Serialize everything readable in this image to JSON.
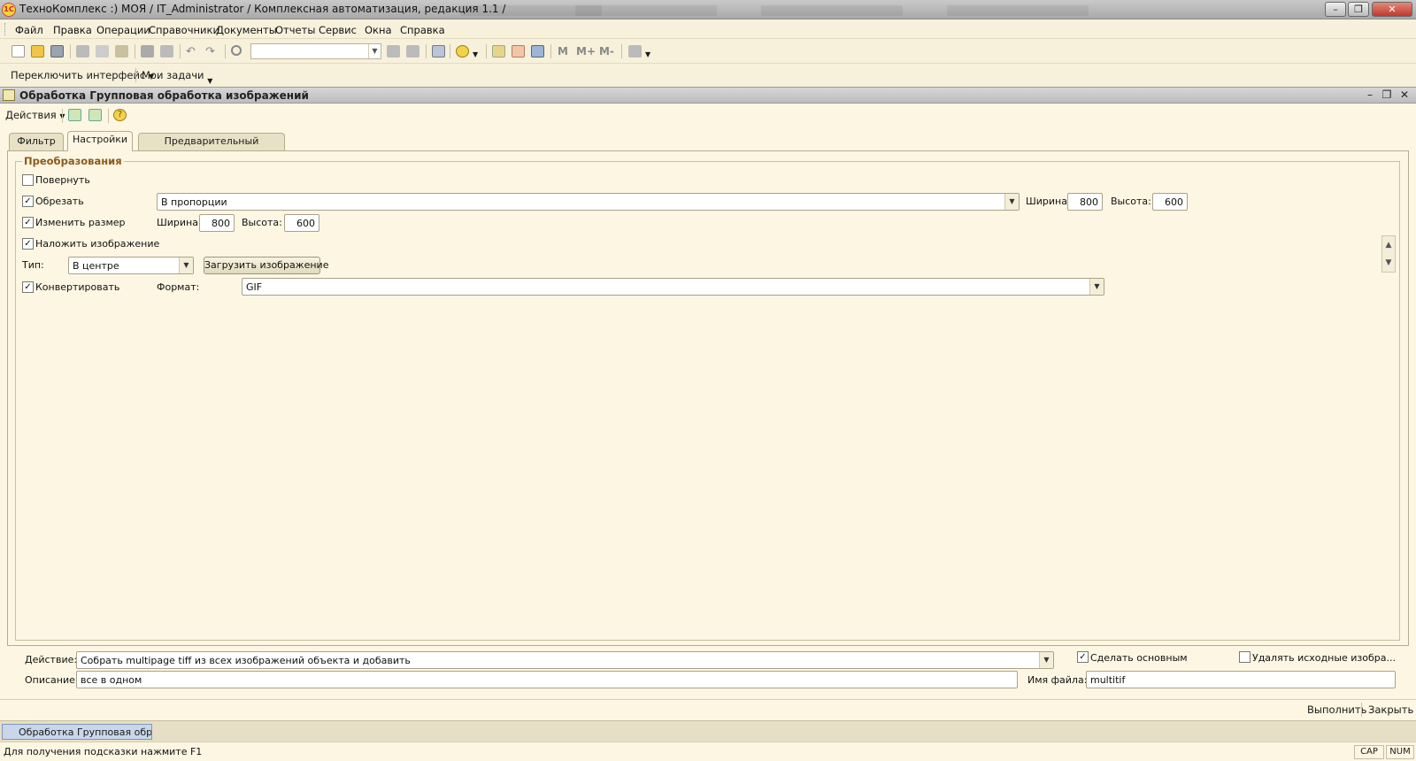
{
  "window": {
    "title": "ТехноКомплекс :) МОЯ / IT_Administrator /  Комплексная автоматизация, редакция 1.1 /",
    "logo": "1С"
  },
  "menu": [
    "Файл",
    "Правка",
    "Операции",
    "Справочники",
    "Документы",
    "Отчеты",
    "Сервис",
    "Окна",
    "Справка"
  ],
  "toolbar": {
    "mem_buttons": [
      "M",
      "M+",
      "M-"
    ]
  },
  "toolbar2": {
    "switch_interface": "Переключить интерфейс",
    "my_tasks": "Мои задачи"
  },
  "child": {
    "title": "Обработка  Групповая обработка изображений",
    "actions": "Действия"
  },
  "tabs": [
    "Фильтр",
    "Настройки",
    "Предварительный просмотр"
  ],
  "active_tab": "Настройки",
  "group_label": "Преобразования",
  "rotate": {
    "label": "Повернуть",
    "checked": false
  },
  "crop": {
    "label": "Обрезать",
    "checked": true,
    "mode": "В пропорции",
    "width_label": "Ширина:",
    "width": "800",
    "height_label": "Высота:",
    "height": "600"
  },
  "resize": {
    "label": "Изменить размер",
    "checked": true,
    "width_label": "Ширина:",
    "width": "800",
    "height_label": "Высота:",
    "height": "600"
  },
  "overlay": {
    "label": "Наложить изображение",
    "checked": true,
    "type_label": "Тип:",
    "type": "В центре",
    "load_button": "Загрузить изображение"
  },
  "convert": {
    "label": "Конвертировать",
    "checked": true,
    "format_label": "Формат:",
    "format": "GIF"
  },
  "bottom_form": {
    "action_label": "Действие:",
    "action": "Собрать multipage tiff из всех изображений объекта и добавить",
    "make_main_label": "Сделать основным",
    "make_main": true,
    "delete_source_label": "Удалять исходные изобра...",
    "delete_source": false,
    "description_label": "Описание:",
    "description": "все в одном",
    "filename_label": "Имя файла:",
    "filename": "multitif"
  },
  "buttons": {
    "execute": "Выполнить",
    "close": "Закрыть"
  },
  "taskbar": {
    "item": "Обработка  Групповая обра..."
  },
  "status": {
    "hint": "Для получения подсказки нажмите F1",
    "cap": "CAP",
    "num": "NUM"
  },
  "colors": {
    "accent_label": "#8b5a1b",
    "background": "#fdf6e3"
  }
}
